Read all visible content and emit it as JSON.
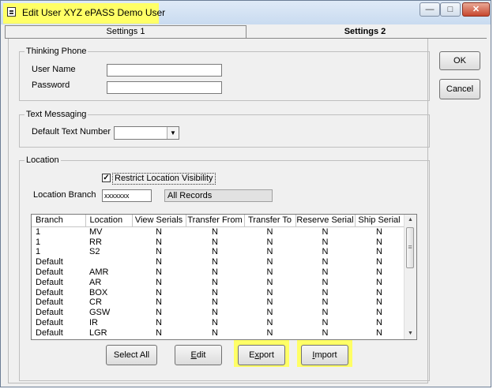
{
  "window": {
    "title": "Edit User XYZ ePASS Demo User",
    "min_glyph": "—",
    "max_glyph": "□",
    "close_glyph": "✕"
  },
  "tabs": [
    {
      "label": "Settings 1"
    },
    {
      "label": "Settings 2"
    }
  ],
  "thinking_phone": {
    "legend": "Thinking Phone",
    "username_label": "User Name",
    "username_value": "",
    "password_label": "Password",
    "password_value": ""
  },
  "text_messaging": {
    "legend": "Text Messaging",
    "default_label": "Default Text Number",
    "default_value": ""
  },
  "location": {
    "legend": "Location",
    "restrict_label": "Restrict Location Visibility",
    "restrict_checked": true,
    "branch_label": "Location Branch",
    "branch_value": "xxxxxxx",
    "branch_description": "All Records",
    "columns": [
      "Branch",
      "Location",
      "View Serials",
      "Transfer From",
      "Transfer To",
      "Reserve Serial",
      "Ship Serial"
    ],
    "rows": [
      [
        "1",
        "MV",
        "N",
        "N",
        "N",
        "N",
        "N"
      ],
      [
        "1",
        "RR",
        "N",
        "N",
        "N",
        "N",
        "N"
      ],
      [
        "1",
        "S2",
        "N",
        "N",
        "N",
        "N",
        "N"
      ],
      [
        "Default",
        "",
        "N",
        "N",
        "N",
        "N",
        "N"
      ],
      [
        "Default",
        "AMR",
        "N",
        "N",
        "N",
        "N",
        "N"
      ],
      [
        "Default",
        "AR",
        "N",
        "N",
        "N",
        "N",
        "N"
      ],
      [
        "Default",
        "BOX",
        "N",
        "N",
        "N",
        "N",
        "N"
      ],
      [
        "Default",
        "CR",
        "N",
        "N",
        "N",
        "N",
        "N"
      ],
      [
        "Default",
        "GSW",
        "N",
        "N",
        "N",
        "N",
        "N"
      ],
      [
        "Default",
        "IR",
        "N",
        "N",
        "N",
        "N",
        "N"
      ],
      [
        "Default",
        "LGR",
        "N",
        "N",
        "N",
        "N",
        "N"
      ]
    ]
  },
  "buttons": {
    "select_all": "Select All",
    "edit_u": "E",
    "edit_rest": "dit",
    "export_head": "E",
    "export_u": "x",
    "export_rest": "port",
    "import_u": "I",
    "import_rest": "mport",
    "ok": "OK",
    "cancel": "Cancel"
  },
  "colors": {
    "highlight": "#ffff66",
    "window_bg": "#f0f0f0"
  }
}
